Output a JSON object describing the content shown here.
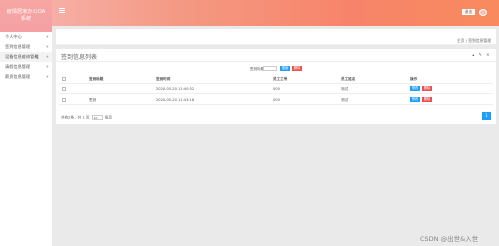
{
  "brand": {
    "line1": "疫情居家办公OA",
    "line2": "系统"
  },
  "topbar": {
    "exit_label": "退出"
  },
  "sidebar": {
    "items": [
      {
        "label": "个人中心",
        "caret": "+"
      },
      {
        "label": "签到信息管理",
        "caret": "+"
      },
      {
        "label": "设备信息维修管理",
        "caret": "+"
      },
      {
        "label": "请假信息管理",
        "caret": "+"
      },
      {
        "label": "薪资信息管理",
        "caret": "+"
      }
    ]
  },
  "breadcrumb": {
    "text": "主页 / 签到信息管理"
  },
  "panel": {
    "title": "签到信息列表",
    "tools": "▴ ✎ ✕",
    "search_label": "签到标题",
    "search_value": "",
    "search_button": "搜索",
    "delete_button": "删除"
  },
  "table": {
    "headers": [
      "",
      "签到标题",
      "签到时间",
      "员工工号",
      "员工姓名",
      "操作"
    ],
    "rows": [
      {
        "title": "",
        "time": "2020-05-20 11:40:52",
        "emp_no": "000",
        "emp_name": "测试",
        "edit": "修改",
        "del": "删除"
      },
      {
        "title": "签到",
        "time": "2020-05-20 11:43:16",
        "emp_no": "000",
        "emp_name": "测试",
        "edit": "修改",
        "del": "删除"
      }
    ]
  },
  "pager": {
    "summary_prefix": "共有2条，共 1 页",
    "page_size": "10",
    "suffix": "每页",
    "next": "1"
  },
  "watermark": "CSDN @出世&入世",
  "colors": {
    "topbar_start": "#f7b7b4",
    "topbar_end": "#f88a5e",
    "primary": "#1e9fff",
    "danger": "#e8514f"
  }
}
